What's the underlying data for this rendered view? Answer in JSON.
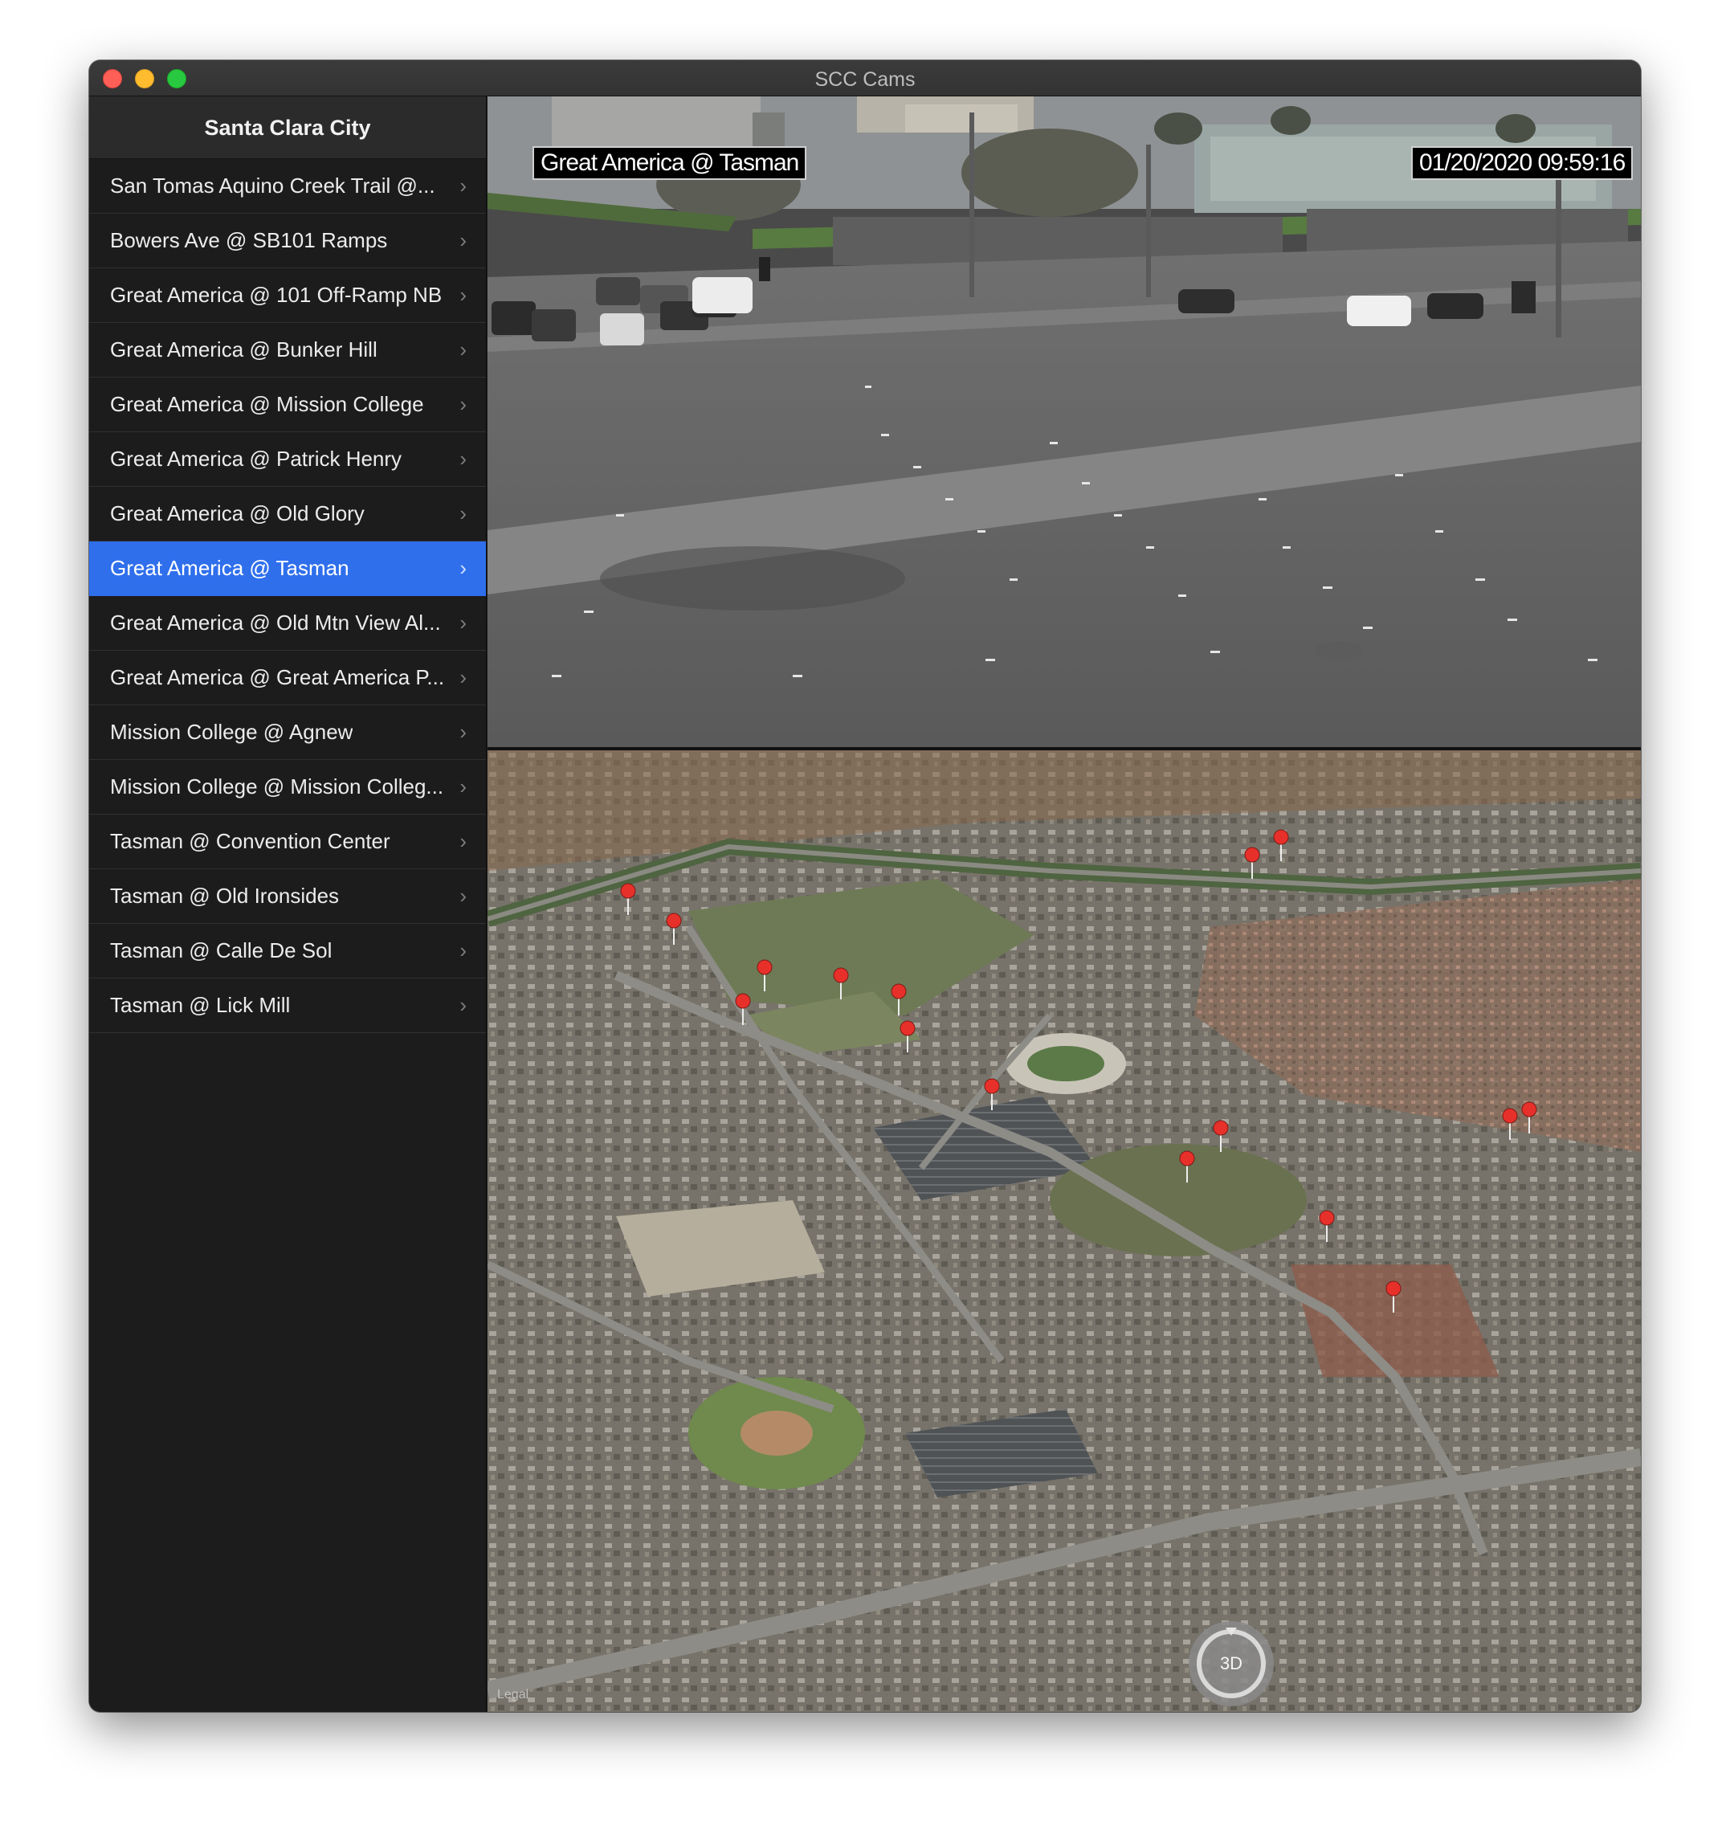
{
  "window": {
    "title": "SCC Cams"
  },
  "sidebar": {
    "title": "Santa Clara City",
    "items": [
      {
        "label": "San Tomas Aquino Creek Trail @..."
      },
      {
        "label": "Bowers Ave @ SB101 Ramps"
      },
      {
        "label": "Great America @ 101 Off-Ramp NB"
      },
      {
        "label": "Great America @ Bunker Hill"
      },
      {
        "label": "Great America @ Mission College"
      },
      {
        "label": "Great America @ Patrick Henry"
      },
      {
        "label": "Great America @ Old Glory"
      },
      {
        "label": "Great America @ Tasman",
        "selected": true
      },
      {
        "label": "Great America @ Old Mtn View Al..."
      },
      {
        "label": "Great America @ Great America P..."
      },
      {
        "label": "Mission College @ Agnew"
      },
      {
        "label": "Mission College @ Mission Colleg..."
      },
      {
        "label": "Tasman @ Convention Center"
      },
      {
        "label": "Tasman @ Old Ironsides"
      },
      {
        "label": "Tasman @ Calle De Sol"
      },
      {
        "label": "Tasman @ Lick Mill"
      }
    ]
  },
  "camera": {
    "location_label": "Great America @ Tasman",
    "timestamp": "01/20/2020  09:59:16"
  },
  "map": {
    "legal_label": "Legal",
    "mode_button": "3D",
    "pin_color": "#e8302a"
  },
  "colors": {
    "selection": "#2f6fec",
    "sidebar_bg": "#1c1c1c"
  }
}
